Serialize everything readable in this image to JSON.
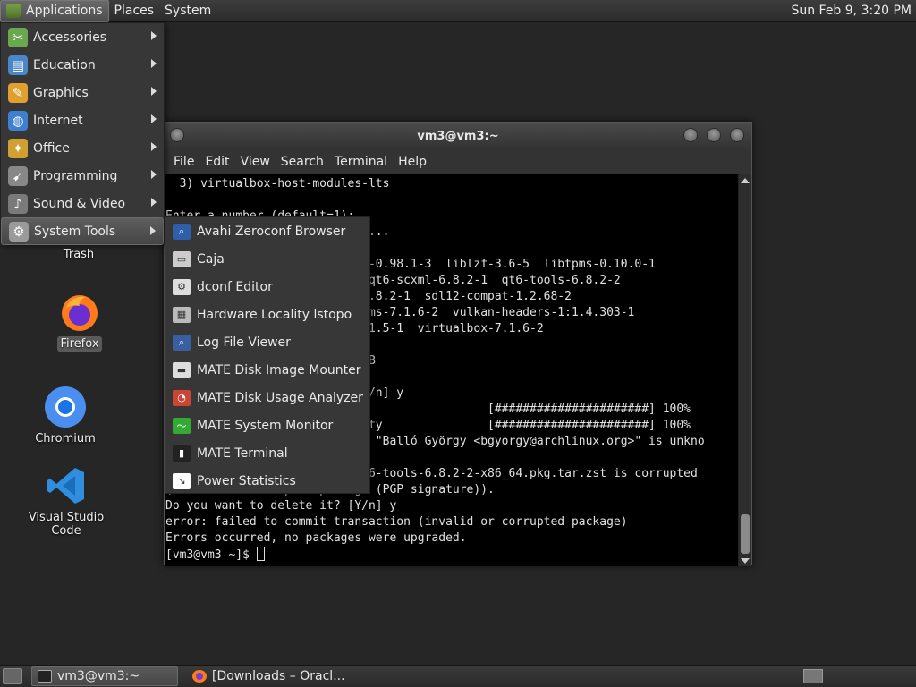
{
  "top_panel": {
    "menus": [
      "Applications",
      "Places",
      "System"
    ],
    "clock": "Sun Feb 9, 3:20 PM"
  },
  "app_menu": {
    "items": [
      {
        "label": "Accessories",
        "icon": "accessories-icon"
      },
      {
        "label": "Education",
        "icon": "education-icon"
      },
      {
        "label": "Graphics",
        "icon": "graphics-icon"
      },
      {
        "label": "Internet",
        "icon": "internet-icon"
      },
      {
        "label": "Office",
        "icon": "office-icon"
      },
      {
        "label": "Programming",
        "icon": "programming-icon"
      },
      {
        "label": "Sound & Video",
        "icon": "sound-video-icon"
      },
      {
        "label": "System Tools",
        "icon": "system-tools-icon",
        "highlighted": true
      }
    ]
  },
  "system_tools_submenu": {
    "items": [
      {
        "label": "Avahi Zeroconf Browser"
      },
      {
        "label": "Caja"
      },
      {
        "label": "dconf Editor"
      },
      {
        "label": "Hardware Locality lstopo"
      },
      {
        "label": "Log File Viewer"
      },
      {
        "label": "MATE Disk Image Mounter"
      },
      {
        "label": "MATE Disk Usage Analyzer"
      },
      {
        "label": "MATE System Monitor"
      },
      {
        "label": "MATE Terminal"
      },
      {
        "label": "Power Statistics"
      }
    ]
  },
  "desktop": {
    "icons": [
      {
        "label": "Trash"
      },
      {
        "label": "Firefox",
        "selected": true
      },
      {
        "label": "Chromium"
      },
      {
        "label": "Visual Studio Code"
      }
    ]
  },
  "terminal": {
    "title": "vm3@vm3:~",
    "menus": [
      "File",
      "Edit",
      "View",
      "Search",
      "Terminal",
      "Help"
    ],
    "lines": [
      "  3) virtualbox-host-modules-lts",
      "",
      "Enter a number (default=1):",
      "                         ages...",
      "",
      "                         ibb2-0.98.1-3  liblzf-3.6-5  libtpms-0.10.0-1",
      "                         -2  qt6-scxml-6.8.2-1  qt6-tools-6.8.2-2",
      "                         ms-6.8.2-1  sdl12-compat-1.2.68-2",
      "                         t-dkms-7.1.6-2  vulkan-headers-1:1.4.303-1",
      "                         f-0.1.5-1  virtualbox-7.1.6-2",
      "",
      "                         0 MiB",
      "",
      "                         ? [Y/n] y",
      "                         ring                 [######################] 100%",
      "                         egrity               [######################] 100%",
      "                         from \"Balló György <bgyorgy@archlinux.org>\" is unkno",
      "",
      "                         g/qt6-tools-6.8.2-2-x86_64.pkg.tar.zst is corrupted",
      "(invalid or corrupted package (PGP signature)).",
      "Do you want to delete it? [Y/n] y",
      "error: failed to commit transaction (invalid or corrupted package)",
      "Errors occurred, no packages were upgraded."
    ],
    "prompt": "[vm3@vm3 ~]$ "
  },
  "taskbar": {
    "buttons": [
      {
        "label": "vm3@vm3:~",
        "active": true
      },
      {
        "label": "[Downloads – Oracl..."
      }
    ]
  }
}
